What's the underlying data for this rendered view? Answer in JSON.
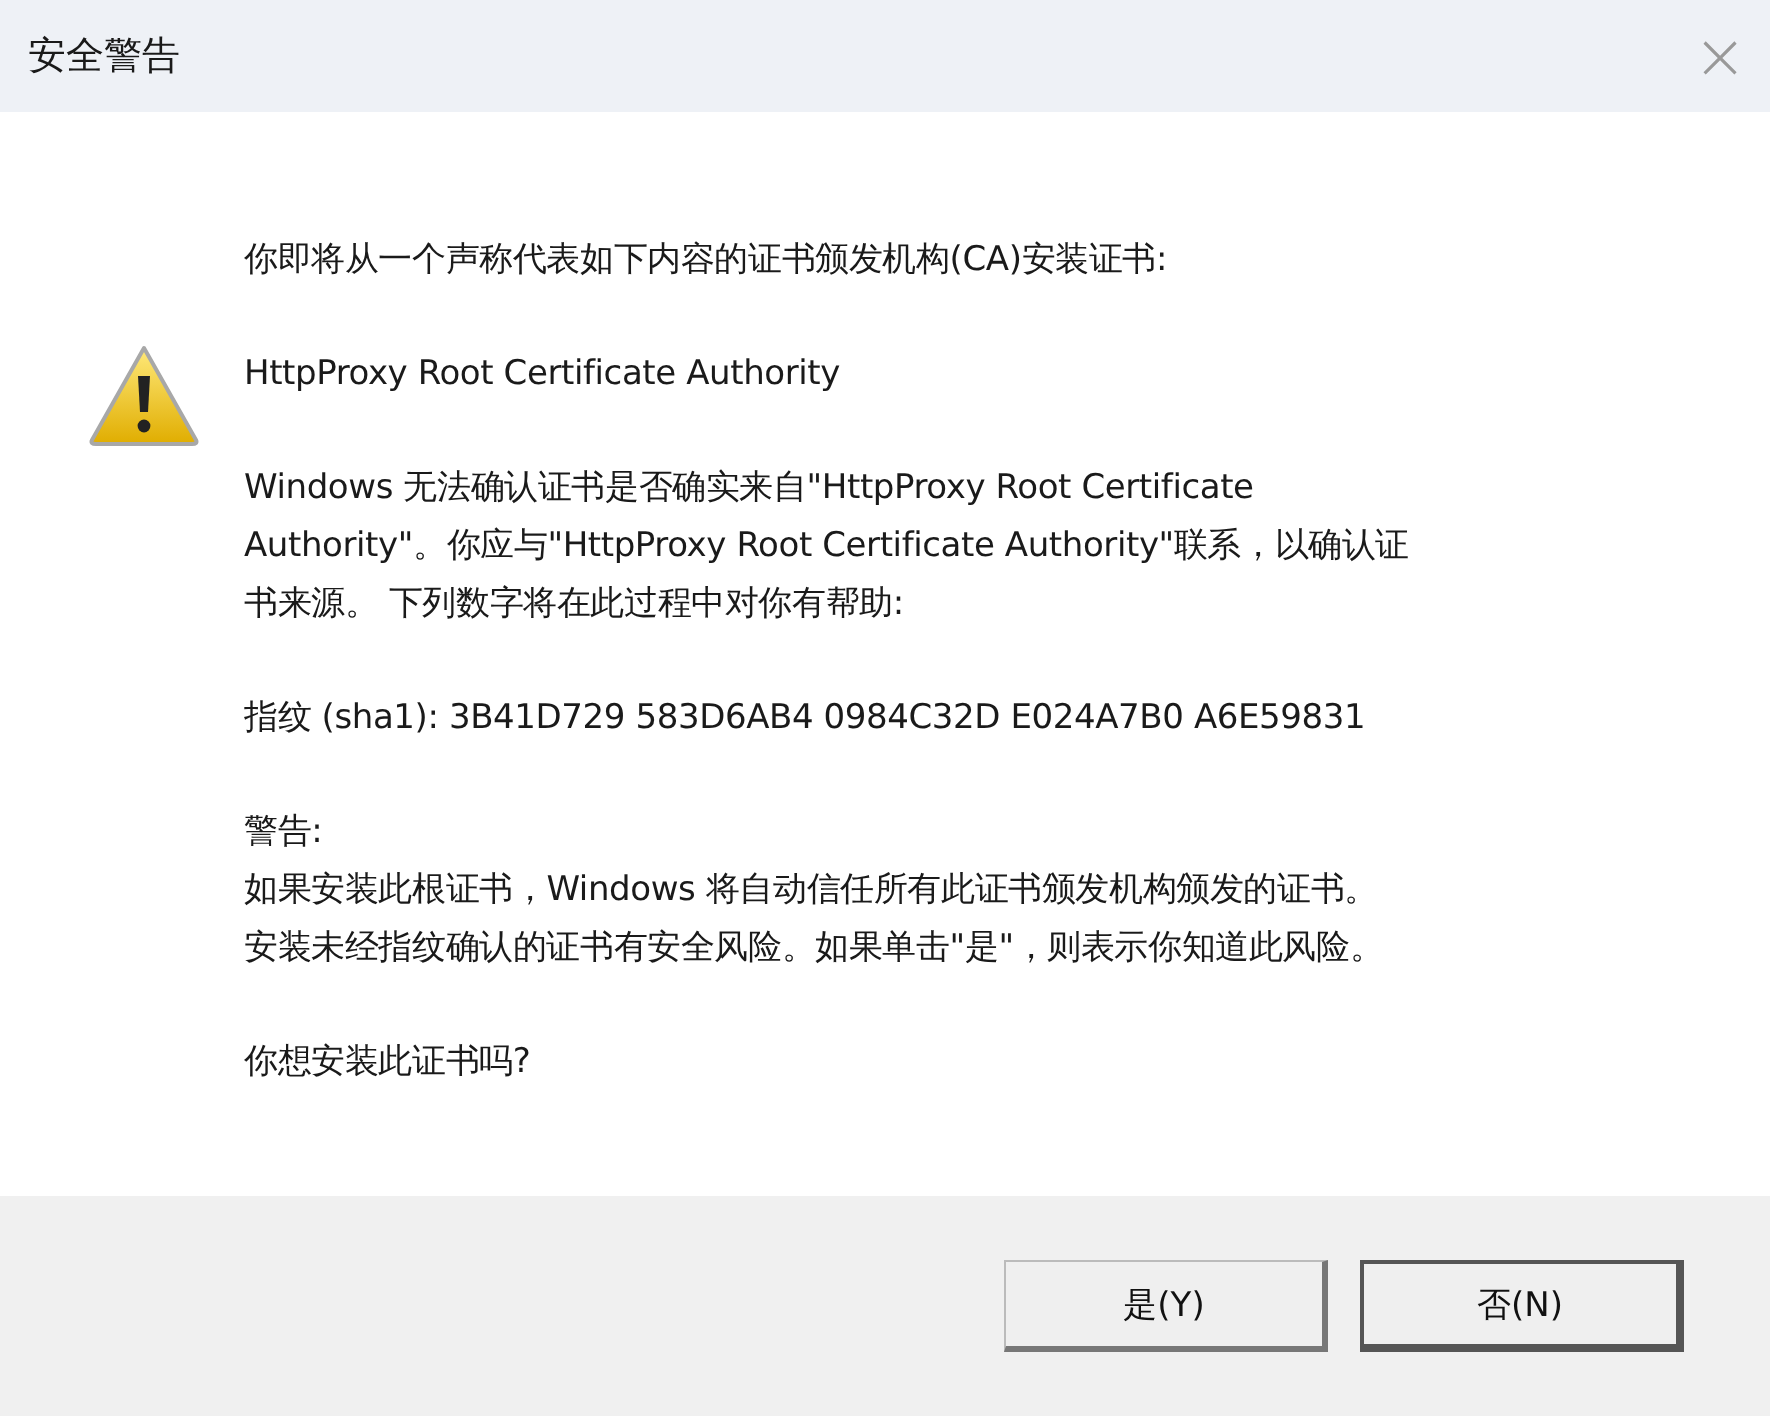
{
  "window": {
    "title": "安全警告",
    "close": "×"
  },
  "paragraphs": [
    {
      "lines": [
        "你即将从一个声称代表如下内容的证书颁发机构(CA)安装证书:"
      ]
    },
    {
      "lines": [
        "HttpProxy Root Certificate Authority"
      ]
    },
    {
      "lines": [
        "Windows 无法确认证书是否确实来自\"HttpProxy Root Certificate",
        "Authority\"。你应与\"HttpProxy Root Certificate Authority\"联系，以确认证",
        "书来源。 下列数字将在此过程中对你有帮助:"
      ]
    },
    {
      "lines": [
        "指纹 (sha1): 3B41D729 583D6AB4 0984C32D E024A7B0 A6E59831"
      ]
    },
    {
      "lines": [
        "警告:",
        "如果安装此根证书，Windows 将自动信任所有此证书颁发机构颁发的证书。",
        "安装未经指纹确认的证书有安全风险。如果单击\"是\"，则表示你知道此风险。"
      ]
    },
    {
      "lines": [
        "你想安装此证书吗?"
      ]
    }
  ],
  "buttons": [
    {
      "label": "是(Y)",
      "default": false
    },
    {
      "label": "否(N)",
      "default": true
    }
  ]
}
